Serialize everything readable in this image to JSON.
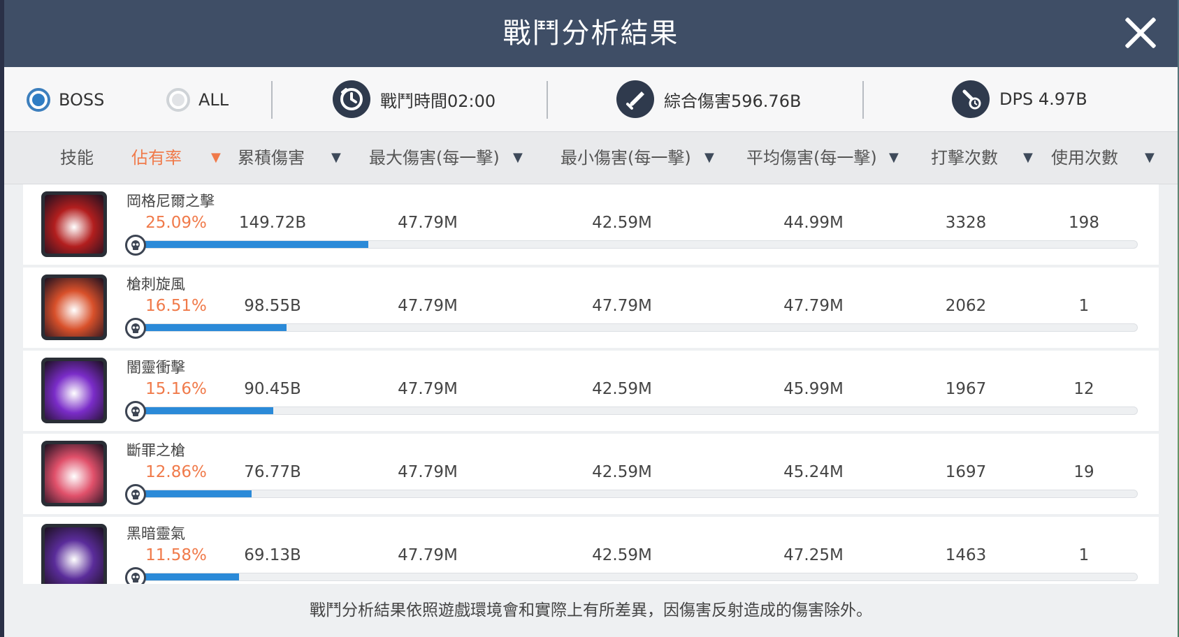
{
  "window": {
    "title": "戰鬥分析結果"
  },
  "filters": {
    "boss_label": "BOSS",
    "all_label": "ALL",
    "selected": "BOSS"
  },
  "stats": {
    "time": "戰鬥時間02:00",
    "total_damage": "綜合傷害596.76B",
    "dps": "DPS 4.97B"
  },
  "columns": [
    {
      "label": "技能"
    },
    {
      "label": "佔有率",
      "active": true
    },
    {
      "label": "累積傷害"
    },
    {
      "label": "最大傷害(每一擊)"
    },
    {
      "label": "最小傷害(每一擊)"
    },
    {
      "label": "平均傷害(每一擊)"
    },
    {
      "label": "打擊次數"
    },
    {
      "label": "使用次數"
    }
  ],
  "sort_arrow": "▼",
  "rows": [
    {
      "name": "岡格尼爾之擊",
      "share": "25.09%",
      "share_value": 25.09,
      "total": "149.72B",
      "max": "47.79M",
      "min": "42.59M",
      "avg": "44.99M",
      "hits": "3328",
      "uses": "198",
      "icon": "crimson-strike-icon",
      "icon_color": "#b21e1e"
    },
    {
      "name": "槍刺旋風",
      "share": "16.51%",
      "share_value": 16.51,
      "total": "98.55B",
      "max": "47.79M",
      "min": "47.79M",
      "avg": "47.79M",
      "hits": "2062",
      "uses": "1",
      "icon": "spear-whirlwind-icon",
      "icon_color": "#d8502a"
    },
    {
      "name": "闇靈衝擊",
      "share": "15.16%",
      "share_value": 15.16,
      "total": "90.45B",
      "max": "47.79M",
      "min": "42.59M",
      "avg": "45.99M",
      "hits": "1967",
      "uses": "12",
      "icon": "dark-spirit-icon",
      "icon_color": "#7a2cc8"
    },
    {
      "name": "斷罪之槍",
      "share": "12.86%",
      "share_value": 12.86,
      "total": "76.77B",
      "max": "47.79M",
      "min": "42.59M",
      "avg": "45.24M",
      "hits": "1697",
      "uses": "19",
      "icon": "judgment-spear-icon",
      "icon_color": "#e0506a"
    },
    {
      "name": "黑暗靈氣",
      "share": "11.58%",
      "share_value": 11.58,
      "total": "69.13B",
      "max": "47.79M",
      "min": "42.59M",
      "avg": "47.25M",
      "hits": "1463",
      "uses": "1",
      "icon": "dark-aura-icon",
      "icon_color": "#5a2c9a"
    }
  ],
  "footer": "戰鬥分析結果依照遊戲環境會和實際上有所差異，因傷害反射造成的傷害除外。",
  "colors": {
    "accent": "#f07a4a",
    "bar": "#2b8ad8",
    "header_bg": "#3f4e66"
  }
}
